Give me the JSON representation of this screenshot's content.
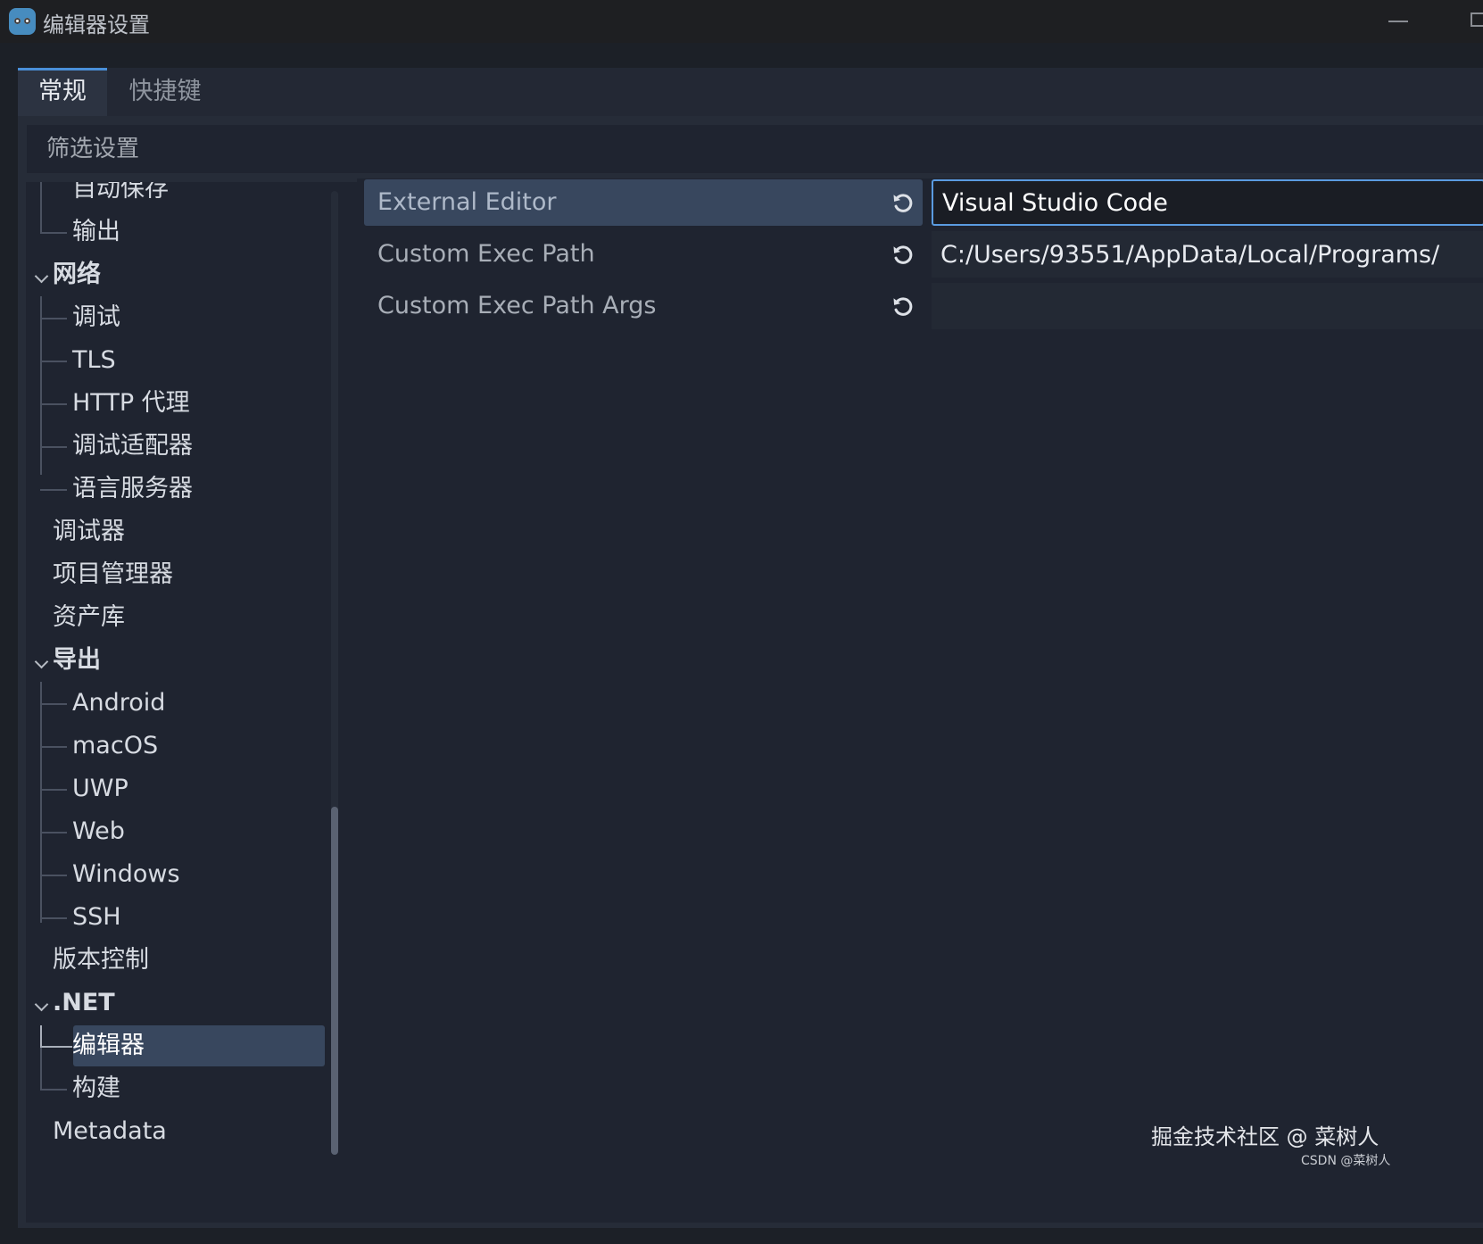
{
  "window": {
    "title": "编辑器设置"
  },
  "tabs": [
    {
      "label": "常规",
      "active": true
    },
    {
      "label": "快捷键",
      "active": false
    }
  ],
  "filter": {
    "placeholder": "筛选设置"
  },
  "tree": {
    "items": [
      {
        "label": "自动保存",
        "level": 1
      },
      {
        "label": "输出",
        "level": 1
      },
      {
        "label": "网络",
        "level": 0,
        "expanded": true
      },
      {
        "label": "调试",
        "level": 1
      },
      {
        "label": "TLS",
        "level": 1
      },
      {
        "label": "HTTP 代理",
        "level": 1
      },
      {
        "label": "调试适配器",
        "level": 1
      },
      {
        "label": "语言服务器",
        "level": 1
      },
      {
        "label": "调试器",
        "level": 0
      },
      {
        "label": "项目管理器",
        "level": 0
      },
      {
        "label": "资产库",
        "level": 0
      },
      {
        "label": "导出",
        "level": 0,
        "expanded": true
      },
      {
        "label": "Android",
        "level": 1
      },
      {
        "label": "macOS",
        "level": 1
      },
      {
        "label": "UWP",
        "level": 1
      },
      {
        "label": "Web",
        "level": 1
      },
      {
        "label": "Windows",
        "level": 1
      },
      {
        "label": "SSH",
        "level": 1
      },
      {
        "label": "版本控制",
        "level": 0
      },
      {
        "label": ".NET",
        "level": 0,
        "expanded": true
      },
      {
        "label": "编辑器",
        "level": 1,
        "selected": true
      },
      {
        "label": "构建",
        "level": 1
      },
      {
        "label": "Metadata",
        "level": 0
      }
    ]
  },
  "properties": [
    {
      "name": "External Editor",
      "value": "Visual Studio Code",
      "selected": true,
      "revert_icon": "revert-icon"
    },
    {
      "name": "Custom Exec Path",
      "value": "C:/Users/93551/AppData/Local/Programs/",
      "revert_icon": "revert-icon"
    },
    {
      "name": "Custom Exec Path Args",
      "value": "",
      "revert_icon": "revert-icon"
    }
  ],
  "watermark": {
    "main": "掘金技术社区 @ 菜树人",
    "small": "CSDN @菜树人"
  },
  "colors": {
    "accent": "#4a8fd8",
    "selection": "#38475e",
    "panel": "#1f2430",
    "background": "#262c38"
  }
}
